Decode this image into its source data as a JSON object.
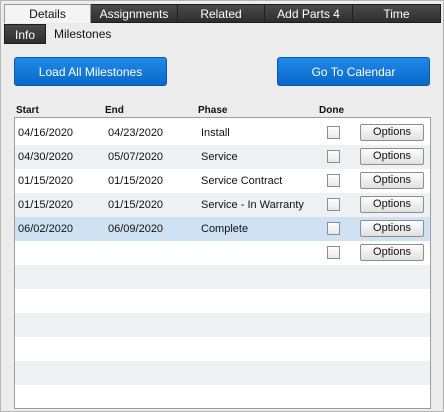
{
  "tabs": [
    {
      "label": "Details",
      "active": true
    },
    {
      "label": "Assignments",
      "active": false
    },
    {
      "label": "Related",
      "active": false
    },
    {
      "label": "Add Parts 4",
      "active": false
    },
    {
      "label": "Time",
      "active": false
    }
  ],
  "sub_tabs": {
    "info": "Info",
    "milestones": "Milestones"
  },
  "buttons": {
    "load_all": "Load All Milestones",
    "go_calendar": "Go To Calendar"
  },
  "columns": {
    "start": "Start",
    "end": "End",
    "phase": "Phase",
    "done": "Done"
  },
  "rows": [
    {
      "start": "04/16/2020",
      "end": "04/23/2020",
      "phase": "Install",
      "done": false,
      "options": "Options"
    },
    {
      "start": "04/30/2020",
      "end": "05/07/2020",
      "phase": "Service",
      "done": false,
      "options": "Options"
    },
    {
      "start": "01/15/2020",
      "end": "01/15/2020",
      "phase": "Service Contract",
      "done": false,
      "options": "Options"
    },
    {
      "start": "01/15/2020",
      "end": "01/15/2020",
      "phase": "Service - In Warranty",
      "done": false,
      "options": "Options"
    },
    {
      "start": "06/02/2020",
      "end": "06/09/2020",
      "phase": "Complete",
      "done": false,
      "options": "Options",
      "selected": true
    },
    {
      "start": "",
      "end": "",
      "phase": "",
      "done": false,
      "options": "Options"
    }
  ],
  "colors": {
    "accent_blue": "#0b68c9",
    "selected_row": "#cfe2f4",
    "tab_dark": "#2e2e2e"
  }
}
